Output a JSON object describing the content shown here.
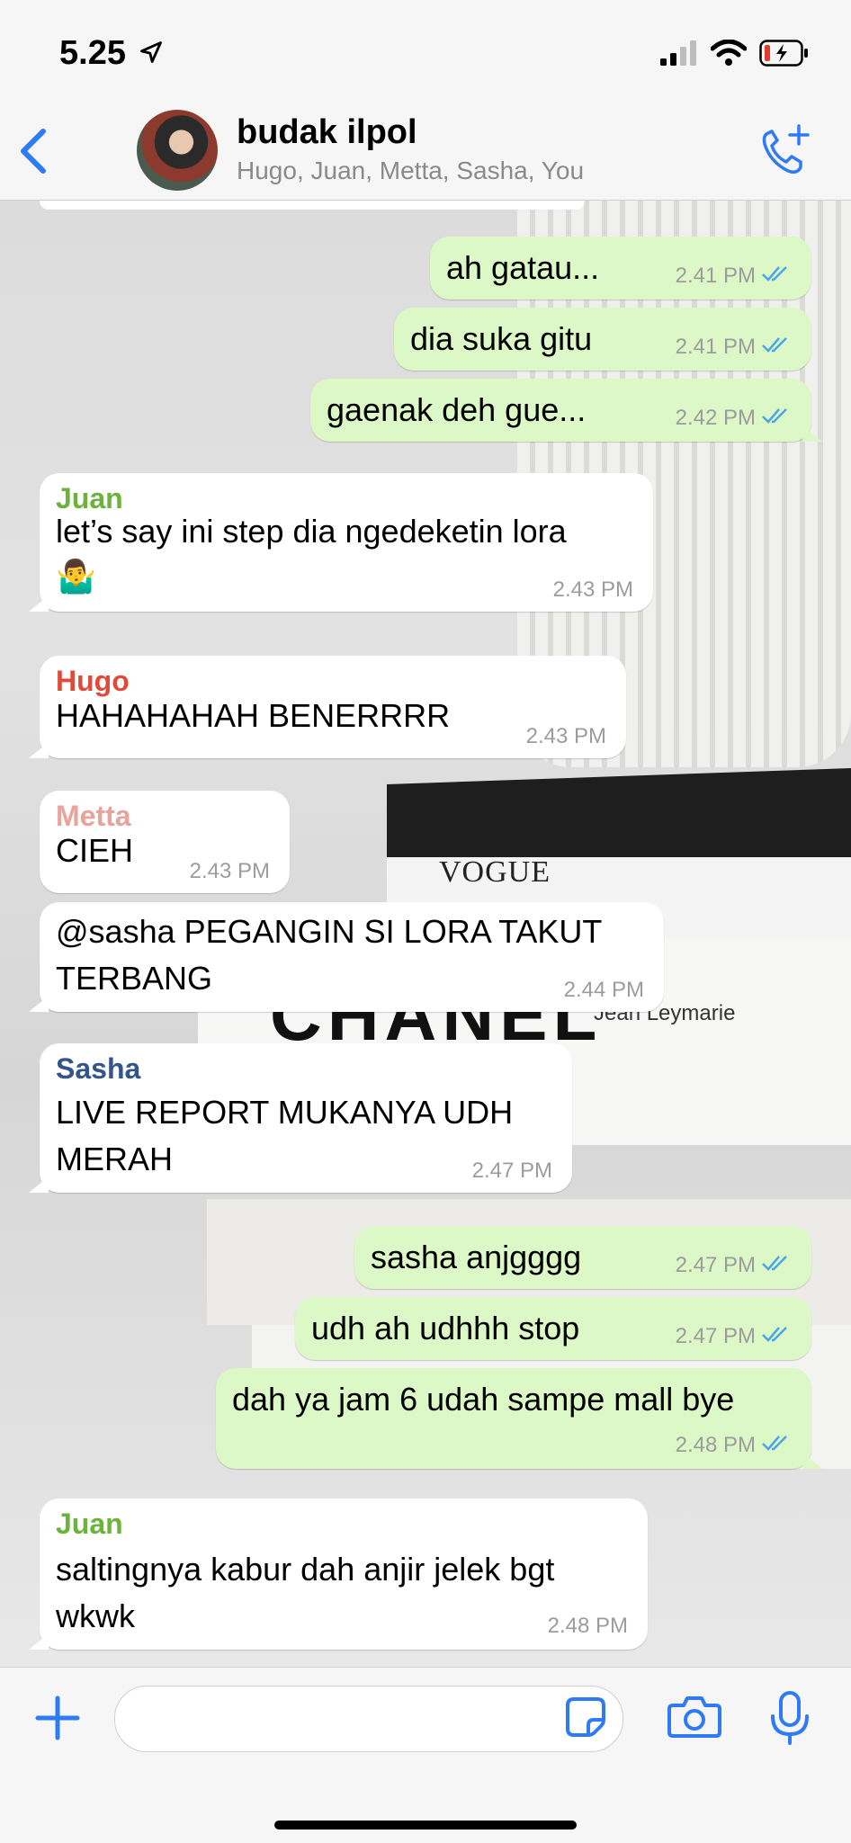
{
  "status_bar": {
    "time": "5.25"
  },
  "header": {
    "title": "budak ilpol",
    "members": "Hugo, Juan, Metta, Sasha, You"
  },
  "colors": {
    "accent": "#2f7bf6",
    "outgoing": "#dcf8c6",
    "incoming": "#ffffff",
    "juan": "#6bb33c",
    "hugo": "#e04a3a",
    "metta": "#e8a39b",
    "sasha": "#34548c"
  },
  "messages": [
    {
      "dir": "out",
      "text": "ah gatau...",
      "time": "2.41 PM"
    },
    {
      "dir": "out",
      "text": "dia suka gitu",
      "time": "2.41 PM"
    },
    {
      "dir": "out",
      "text": "gaenak deh gue...",
      "time": "2.42 PM"
    },
    {
      "dir": "in",
      "sender": "Juan",
      "text": "let’s say ini step dia ngedeketin lora",
      "emoji": "🤷‍♂️",
      "time": "2.43 PM"
    },
    {
      "dir": "in",
      "sender": "Hugo",
      "text": "HAHAHAHAH BENERRRR",
      "time": "2.43 PM"
    },
    {
      "dir": "in",
      "sender": "Metta",
      "text": "CIEH",
      "time": "2.43 PM"
    },
    {
      "dir": "in",
      "text_line1": "@sasha PEGANGIN SI LORA TAKUT",
      "text_line2": "TERBANG",
      "time": "2.44 PM"
    },
    {
      "dir": "in",
      "sender": "Sasha",
      "text_line1": "LIVE REPORT MUKANYA UDH",
      "text_line2": "MERAH",
      "time": "2.47 PM"
    },
    {
      "dir": "out",
      "text": "sasha anjgggg",
      "time": "2.47 PM"
    },
    {
      "dir": "out",
      "text": "udh ah udhhh stop",
      "time": "2.47 PM"
    },
    {
      "dir": "out",
      "text": "dah ya jam 6 udah sampe mall bye",
      "time": "2.48 PM"
    },
    {
      "dir": "in",
      "sender": "Juan",
      "text_line1": "saltingnya kabur dah anjir jelek bgt",
      "text_line2": "wkwk",
      "time": "2.48 PM"
    }
  ],
  "background": {
    "vogue": "VOGUE",
    "chanel": "CHANEL",
    "author": "Jean Leymarie"
  }
}
